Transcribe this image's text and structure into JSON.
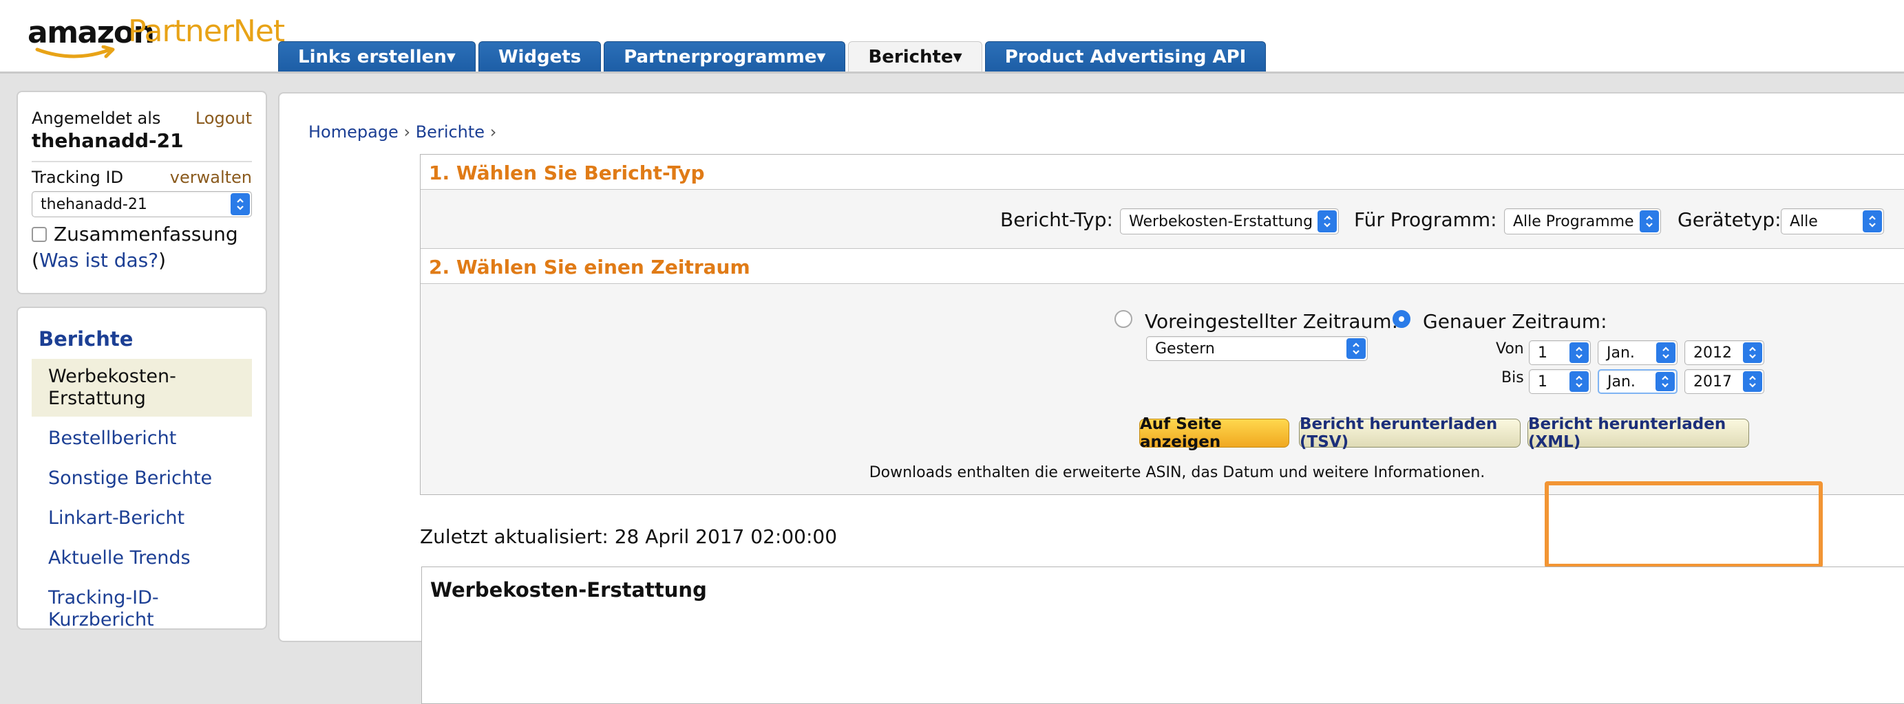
{
  "logo": {
    "amazon": "amazon",
    "partnernet": "PartnerNet"
  },
  "nav_tabs": [
    {
      "label": "Links erstellen▾",
      "active": false
    },
    {
      "label": "Widgets",
      "active": false
    },
    {
      "label": "Partnerprogramme▾",
      "active": false
    },
    {
      "label": "Berichte▾",
      "active": true
    },
    {
      "label": "Product Advertising API",
      "active": false
    }
  ],
  "account": {
    "logged_in_label": "Angemeldet als",
    "logout_label": "Logout",
    "username": "thehanadd-21",
    "tracking_label": "Tracking ID",
    "manage_label": "verwalten",
    "tracking_id_value": "thehanadd-21",
    "summary_label": "Zusammenfassung",
    "help_open": "(",
    "help_link": "Was ist das?",
    "help_close": ")"
  },
  "reports_nav": {
    "heading": "Berichte",
    "items": [
      {
        "label": "Werbekosten-Erstattung",
        "selected": true
      },
      {
        "label": "Bestellbericht",
        "selected": false
      },
      {
        "label": "Sonstige Berichte",
        "selected": false
      },
      {
        "label": "Linkart-Bericht",
        "selected": false
      },
      {
        "label": "Aktuelle Trends",
        "selected": false
      },
      {
        "label": "Tracking-ID-Kurzbericht",
        "selected": false
      }
    ]
  },
  "breadcrumb": {
    "home": "Homepage",
    "reports": "Berichte",
    "sep": "›"
  },
  "section1": {
    "title": "1. Wählen Sie Bericht-Typ",
    "report_type_label": "Bericht-Typ:",
    "report_type_value": "Werbekosten-Erstattung",
    "program_label": "Für Programm:",
    "program_value": "Alle Programme",
    "device_label": "Gerätetyp:",
    "device_value": "Alle"
  },
  "section2": {
    "title": "2. Wählen Sie einen Zeitraum",
    "preset_label": "Voreingestellter Zeitraum:",
    "preset_value": "Gestern",
    "exact_label": "Genauer Zeitraum:",
    "from_label": "Von",
    "to_label": "Bis",
    "from_day": "1",
    "from_month": "Jan.",
    "from_year": "2012",
    "to_day": "1",
    "to_month": "Jan.",
    "to_year": "2017"
  },
  "buttons": {
    "show": "Auf Seite anzeigen",
    "download_tsv": "Bericht herunterladen (TSV)",
    "download_xml": "Bericht herunterladen (XML)"
  },
  "downloads_note": "Downloads enthalten die erweiterte ASIN, das Datum und weitere Informationen.",
  "last_updated": "Zuletzt aktualisiert: 28 April 2017 02:00:00",
  "results_title": "Werbekosten-Erstattung",
  "colors": {
    "accent_orange": "#e07b16",
    "link_blue": "#1c3f94",
    "tab_blue": "#2268b2",
    "highlight": "#f29534"
  }
}
